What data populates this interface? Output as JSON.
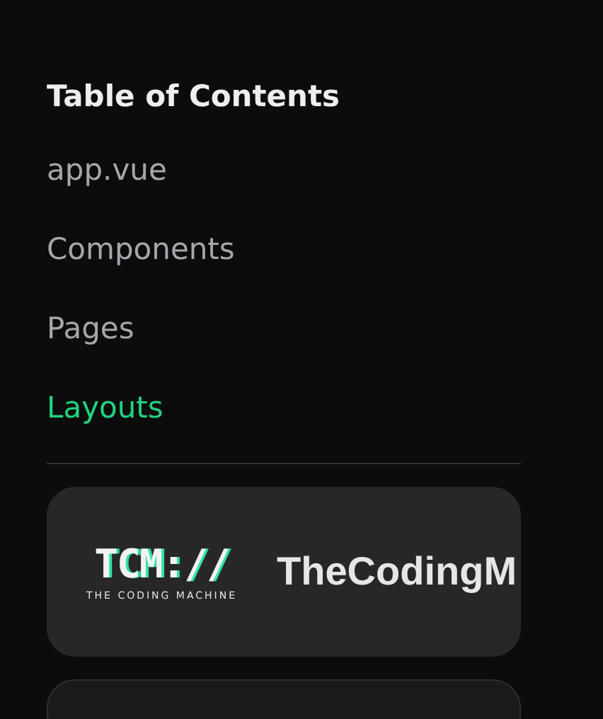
{
  "toc": {
    "title": "Table of Contents",
    "items": [
      {
        "label": "app.vue",
        "selected": false
      },
      {
        "label": "Components",
        "selected": false
      },
      {
        "label": "Pages",
        "selected": false
      },
      {
        "label": "Layouts",
        "selected": true
      }
    ]
  },
  "sponsor_card": {
    "logo_mark": "TCM://",
    "logo_tagline": "THE CODING MACHINE",
    "name": "TheCodingM"
  }
}
